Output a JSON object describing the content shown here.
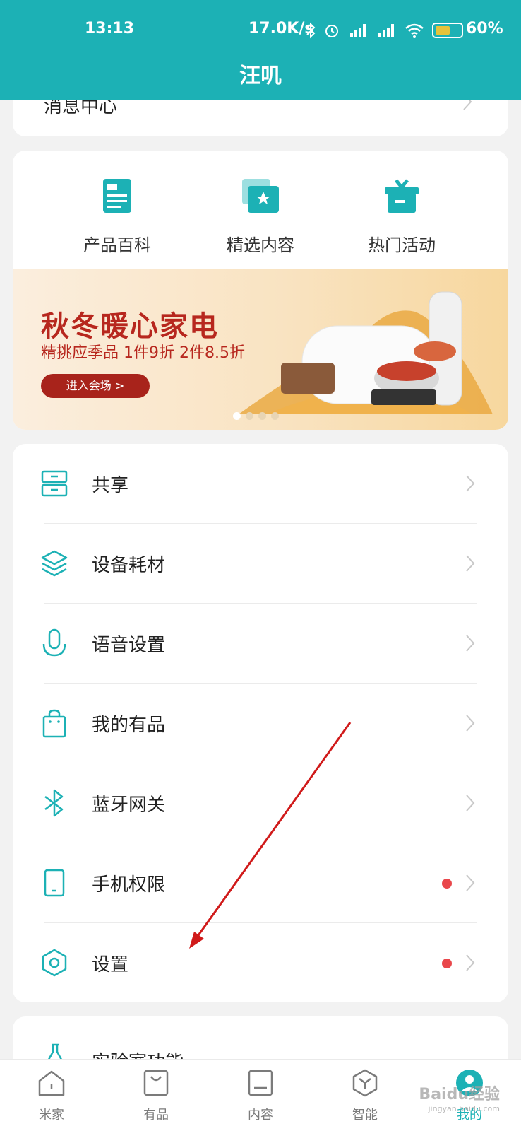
{
  "status_bar": {
    "time": "13:13",
    "net_speed": "17.0K/s",
    "battery": "60%",
    "battery_level": 0.6
  },
  "header": {
    "title": "汪叽"
  },
  "top_card": {
    "partial_item_label": "消息中心"
  },
  "shortcuts": [
    {
      "label": "产品百科",
      "icon": "encyclopedia-icon"
    },
    {
      "label": "精选内容",
      "icon": "featured-star-icon"
    },
    {
      "label": "热门活动",
      "icon": "gift-icon"
    }
  ],
  "banner": {
    "title": "秋冬暖心家电",
    "subtitle": "精挑应季品 1件9折 2件8.5折",
    "button_label": "进入会场 >",
    "page_count": 4,
    "active_page": 1
  },
  "menu_items": [
    {
      "label": "共享",
      "icon": "share-icon",
      "badge": false
    },
    {
      "label": "设备耗材",
      "icon": "layers-icon",
      "badge": false
    },
    {
      "label": "语音设置",
      "icon": "microphone-icon",
      "badge": false
    },
    {
      "label": "我的有品",
      "icon": "shopping-bag-icon",
      "badge": false
    },
    {
      "label": "蓝牙网关",
      "icon": "bluetooth-icon",
      "badge": false
    },
    {
      "label": "手机权限",
      "icon": "phone-icon",
      "badge": true
    },
    {
      "label": "设置",
      "icon": "gear-icon",
      "badge": true
    }
  ],
  "bottom_card": {
    "label": "实验室功能"
  },
  "tabbar": [
    {
      "label": "米家",
      "icon": "home-icon",
      "active": false
    },
    {
      "label": "有品",
      "icon": "bag-icon",
      "active": false
    },
    {
      "label": "内容",
      "icon": "content-icon",
      "active": false
    },
    {
      "label": "智能",
      "icon": "smart-cube-icon",
      "active": false
    },
    {
      "label": "我的",
      "icon": "profile-icon",
      "active": true
    }
  ],
  "colors": {
    "brand": "#1cb1b5",
    "badge": "#e9474b",
    "banner_red": "#b7271e",
    "annotation_arrow": "#d01a1a"
  },
  "watermark": {
    "text": "Baidu经验",
    "sub": "jingyan.baidu.com"
  }
}
